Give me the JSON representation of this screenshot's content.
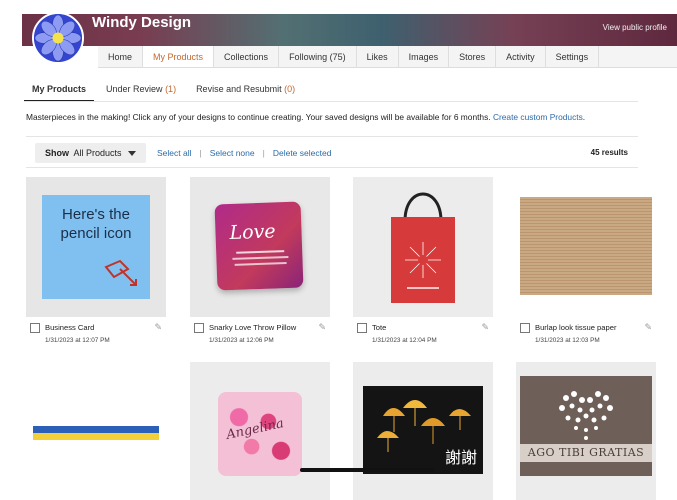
{
  "header": {
    "store_name": "Windy Design",
    "view_profile": "View public profile"
  },
  "nav": {
    "tabs": [
      {
        "label": "Home",
        "active": false
      },
      {
        "label": "My Products",
        "active": true
      },
      {
        "label": "Collections",
        "active": false
      },
      {
        "label": "Following (75)",
        "active": false
      },
      {
        "label": "Likes",
        "active": false
      },
      {
        "label": "Images",
        "active": false
      },
      {
        "label": "Stores",
        "active": false
      },
      {
        "label": "Activity",
        "active": false
      },
      {
        "label": "Settings",
        "active": false
      }
    ]
  },
  "subtabs": {
    "my_products": "My Products",
    "under_review": "Under Review",
    "under_review_count": "(1)",
    "revise": "Revise and Resubmit",
    "revise_count": "(0)"
  },
  "intro": {
    "text": "Masterpieces in the making! Click any of your designs to continue creating. Your saved designs will be available for 6 months.",
    "link": "Create custom Products",
    "trail": "."
  },
  "toolbar": {
    "show_label": "Show",
    "show_value": "All Products",
    "select_all": "Select all",
    "select_none": "Select none",
    "delete_selected": "Delete selected",
    "results": "45 results"
  },
  "products": [
    {
      "title": "Business Card",
      "date": "1/31/2023 at 12:07 PM",
      "thumb_text": "Here's the pencil icon"
    },
    {
      "title": "Snarky Love Throw Pillow",
      "date": "1/31/2023 at 12:06 PM",
      "thumb_text": "Love"
    },
    {
      "title": "Tote",
      "date": "1/31/2023 at 12:04 PM"
    },
    {
      "title": "Burlap look tissue paper",
      "date": "1/31/2023 at 12:03 PM"
    }
  ],
  "bottom_row": [
    {
      "name": "flag-ribbon"
    },
    {
      "name": "hearts-pillow",
      "thumb_text": "Angelina"
    },
    {
      "name": "umbrellas-card",
      "thumb_text": "謝謝"
    },
    {
      "name": "heart-card",
      "thumb_text": "AGO TIBI GRATIAS"
    }
  ],
  "colors": {
    "accent": "#c4672e",
    "link": "#2c6ba8"
  }
}
